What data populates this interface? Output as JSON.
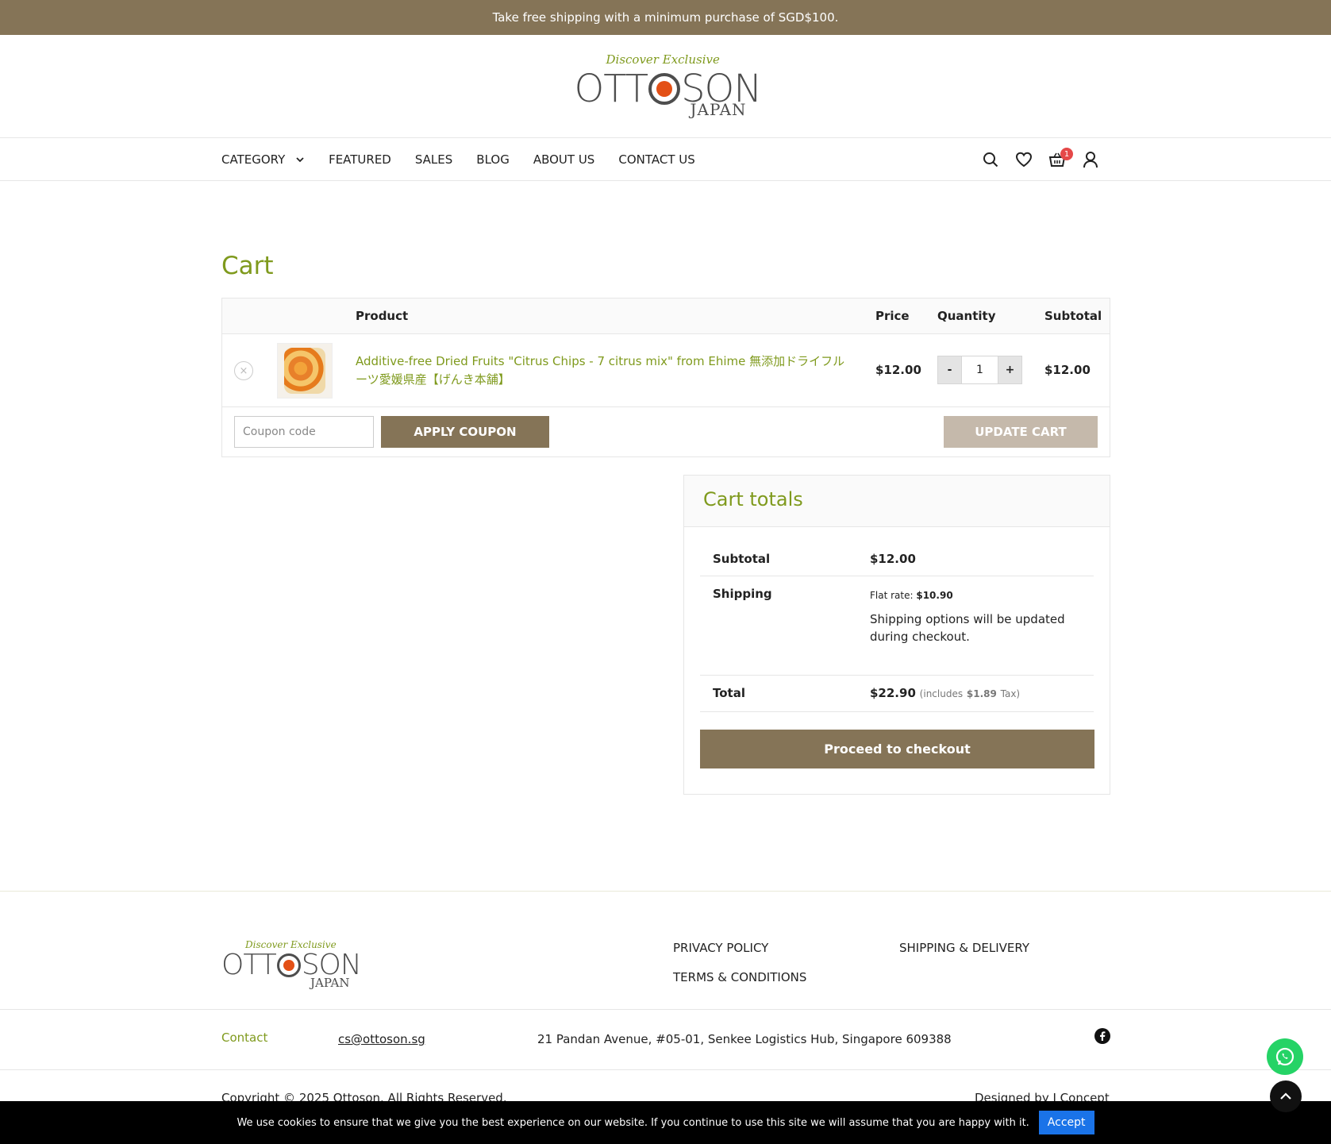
{
  "announcement": "Take free shipping with a minimum purchase of SGD$100.",
  "brand": {
    "tagline": "Discover Exclusive",
    "name_left": "OTT",
    "name_right": "SON",
    "sub": "JAPAN"
  },
  "nav": {
    "items": [
      "CATEGORY",
      "FEATURED",
      "SALES",
      "BLOG",
      "ABOUT US",
      "CONTACT US"
    ],
    "cart_count": "1"
  },
  "page_title": "Cart",
  "cart": {
    "headers": {
      "product": "Product",
      "price": "Price",
      "quantity": "Quantity",
      "subtotal": "Subtotal"
    },
    "items": [
      {
        "name": "Additive-free Dried Fruits \"Citrus Chips - 7 citrus mix\" from Ehime 無添加ドライフルーツ愛媛県産【げんき本舗】",
        "price": "$12.00",
        "qty": "1",
        "subtotal": "$12.00"
      }
    ],
    "coupon_placeholder": "Coupon code",
    "apply_label": "APPLY COUPON",
    "update_label": "UPDATE CART",
    "minus": "-",
    "plus": "+",
    "remove": "×"
  },
  "totals": {
    "title": "Cart totals",
    "subtotal_label": "Subtotal",
    "subtotal": "$12.00",
    "shipping_label": "Shipping",
    "flat_rate_label": "Flat rate:",
    "flat_rate": "$10.90",
    "shipping_note": "Shipping options will be updated during checkout.",
    "total_label": "Total",
    "total": "$22.90",
    "tax_prefix": "(includes",
    "tax": "$1.89",
    "tax_suffix": "Tax)",
    "checkout_label": "Proceed to checkout"
  },
  "footer": {
    "links": [
      "PRIVACY POLICY",
      "SHIPPING & DELIVERY",
      "TERMS & CONDITIONS"
    ],
    "contact_label": "Contact",
    "email": "cs@ottoson.sg",
    "address": "21 Pandan Avenue, #05-01, Senkee Logistics Hub, Singapore 609388",
    "copyright": "Copyright © 2025 Ottoson. All Rights Reserved.",
    "designed_by": "Designed by I Concept"
  },
  "cookie": {
    "text": "We use cookies to ensure that we give you the best experience on our website. If you continue to use this site we will assume that you are happy with it.",
    "accept": "Accept"
  },
  "colors": {
    "brand_brown": "#857457",
    "accent_green": "#7f9a1d",
    "logo_red": "#e35016"
  }
}
